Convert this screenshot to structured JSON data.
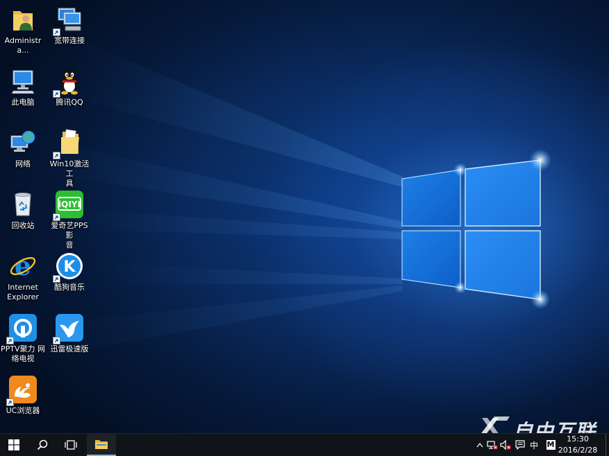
{
  "desktop": {
    "icons": [
      {
        "name": "Administra...",
        "line2": ""
      },
      {
        "name": "宽带连接",
        "line2": ""
      },
      {
        "name": "此电脑",
        "line2": ""
      },
      {
        "name": "腾讯QQ",
        "line2": ""
      },
      {
        "name": "网络",
        "line2": ""
      },
      {
        "name": "Win10激活工",
        "line2": "具"
      },
      {
        "name": "回收站",
        "line2": ""
      },
      {
        "name": "爱奇艺PPS 影",
        "line2": "音"
      },
      {
        "name": "Internet",
        "line2": "Explorer"
      },
      {
        "name": "酷狗音乐",
        "line2": ""
      },
      {
        "name": "PPTV聚力 网",
        "line2": "络电视"
      },
      {
        "name": "迅雷极速版",
        "line2": ""
      },
      {
        "name": "UC浏览器",
        "line2": ""
      }
    ],
    "iqiyi_logo_text": "iQIYI",
    "kugou_logo_text": "K"
  },
  "taskbar": {
    "start_icon": "windows-logo-icon",
    "search_icon": "search-icon",
    "taskview_icon": "task-view-icon",
    "explorer_icon": "folder-icon"
  },
  "tray": {
    "chevron": "^",
    "ime": "中",
    "ime_mode": "M",
    "time": "15:30",
    "date": "2016/2/28"
  },
  "watermark": {
    "text": "自由互联"
  },
  "colors": {
    "taskbar_bg": "#101418",
    "active_underline": "#76b9ed",
    "wallpaper_glow": "#3c96ff"
  }
}
